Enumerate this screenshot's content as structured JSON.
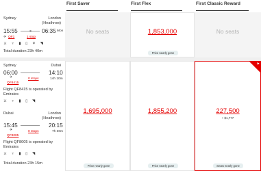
{
  "columns": [
    "First Saver",
    "First Flex",
    "First Classic Reward"
  ],
  "itinerary1": {
    "from_city": "Sydney",
    "to_city": "London",
    "to_airport": "(Heathrow)",
    "depart": "15:55",
    "arrive": "06:35",
    "arrive_offset": "Mon",
    "flight_no": "QF1",
    "stops": "1 stop",
    "total_duration": "Total duration 23h 40m",
    "amenities": "⚔ ♆ ▮ ▯ ⚘ ◥",
    "cells": {
      "saver": "No seats",
      "flex_price": "1,853,000",
      "flex_badge": "Price nearly gone",
      "reward": "No seats"
    }
  },
  "itinerary2": {
    "seg1": {
      "from_city": "Sydney",
      "to_city": "Dubai",
      "depart": "06:00",
      "arrive": "14:10",
      "flight_no": "QF8415",
      "stops": "0 stops",
      "duration": "14h 10m",
      "operated": "Flight QF8415 is operated by",
      "operator": "Emirates",
      "amenities": "⚔ ♆ ▮ ▯ ◥"
    },
    "seg2": {
      "from_city": "Dubai",
      "to_city": "London",
      "to_airport": "(Heathrow)",
      "depart": "15:45",
      "arrive": "20:15",
      "flight_no": "QF8005",
      "stops": "0 stops",
      "duration": "7h 30m",
      "operated": "Flight QF8005 is operated by",
      "operator": "Emirates",
      "amenities": "⚔ ♆ ▮ ▯ ◥"
    },
    "total_duration": "Total duration 23h 15m",
    "cells": {
      "saver_price": "1,695,000",
      "saver_badge": "Price nearly gone",
      "flex_price": "1,855,200",
      "flex_badge": "Price nearly gone",
      "reward_price": "227,500",
      "reward_plus": "+ $1,777",
      "reward_badge": "Seats nearly gone"
    }
  },
  "colors": {
    "accent": "#e40000",
    "badge_bg": "#e6eff0",
    "muted": "#b3b3b3"
  }
}
